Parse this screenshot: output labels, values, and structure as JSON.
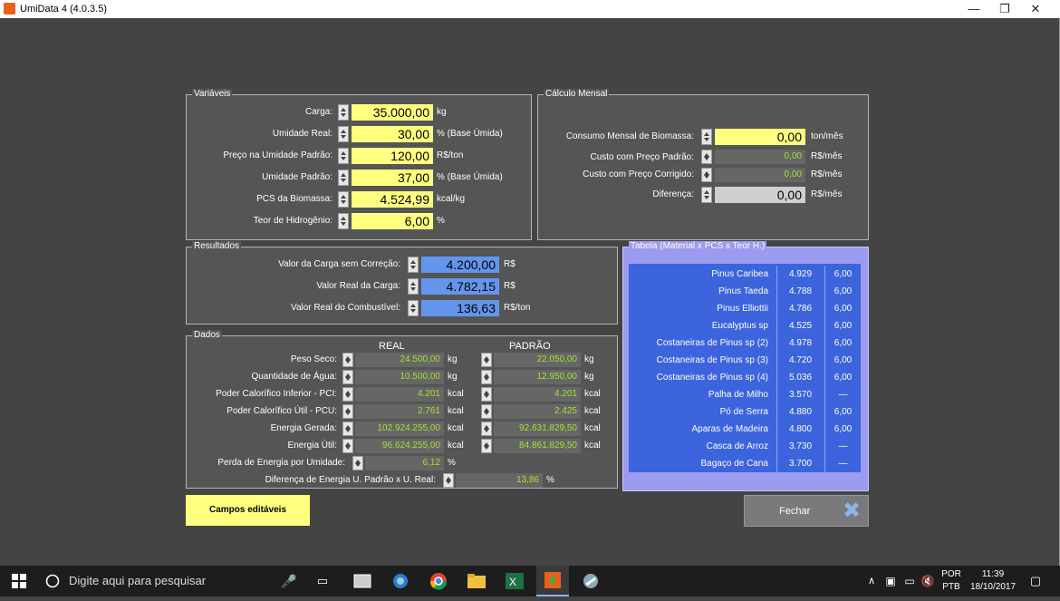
{
  "window": {
    "title": "UmiData 4 (4.0.3.5)",
    "minimize": "—",
    "maximize": "❐",
    "close": "✕"
  },
  "variaveis": {
    "title": "Variáveis",
    "rows": [
      {
        "label": "Carga:",
        "value": "35.000,00",
        "unit": "kg"
      },
      {
        "label": "Umidade Real:",
        "value": "30,00",
        "unit": "% (Base Úmida)"
      },
      {
        "label": "Preço na Umidade Padrão:",
        "value": "120,00",
        "unit": "R$/ton"
      },
      {
        "label": "Umidade Padrão:",
        "value": "37,00",
        "unit": "% (Base Úmida)"
      },
      {
        "label": "PCS da Biomassa:",
        "value": "4.524,99",
        "unit": "kcal/kg"
      },
      {
        "label": "Teor de Hidrogênio:",
        "value": "6,00",
        "unit": "%"
      }
    ]
  },
  "calculo": {
    "title": "Cálculo Mensal",
    "rows": [
      {
        "label": "Consumo Mensal de Biomassa:",
        "value": "0,00",
        "unit": "ton/mês"
      },
      {
        "label": "Custo com Preço Padrão:",
        "value": "0,00",
        "unit": "R$/mês"
      },
      {
        "label": "Custo com Preço Corrigido:",
        "value": "0,00",
        "unit": "R$/mês"
      },
      {
        "label": "Diferença:",
        "value": "0,00",
        "unit": "R$/mês"
      }
    ]
  },
  "resultados": {
    "title": "Resultados",
    "rows": [
      {
        "label": "Valor da Carga sem Correção:",
        "value": "4.200,00",
        "unit": "R$"
      },
      {
        "label": "Valor Real da Carga:",
        "value": "4.782,15",
        "unit": "R$"
      },
      {
        "label": "Valor Real do Combustível:",
        "value": "136,63",
        "unit": "R$/ton"
      }
    ]
  },
  "dados": {
    "title": "Dados",
    "col_real": "REAL",
    "col_padrao": "PADRÃO",
    "rows": [
      {
        "label": "Peso Seco:",
        "real": "24.500,00",
        "real_unit": "kg",
        "padrao": "22.050,00",
        "padrao_unit": "kg"
      },
      {
        "label": "Quantidade de Água:",
        "real": "10.500,00",
        "real_unit": "kg",
        "padrao": "12.950,00",
        "padrao_unit": "kg"
      },
      {
        "label": "Poder Calorífico Inferior - PCI:",
        "real": "4.201",
        "real_unit": "kcal",
        "padrao": "4.201",
        "padrao_unit": "kcal"
      },
      {
        "label": "Poder Calorífico Útil - PCU:",
        "real": "2.761",
        "real_unit": "kcal",
        "padrao": "2.425",
        "padrao_unit": "kcal"
      },
      {
        "label": "Energia Gerada:",
        "real": "102.924.255,00",
        "real_unit": "kcal",
        "padrao": "92.631.829,50",
        "padrao_unit": "kcal"
      },
      {
        "label": "Energia Útil:",
        "real": "96.624.255,00",
        "real_unit": "kcal",
        "padrao": "84.861.829,50",
        "padrao_unit": "kcal"
      }
    ],
    "perda": {
      "label": "Perda de Energia por Umidade:",
      "value": "6,12",
      "unit": "%"
    },
    "diferenca": {
      "label": "Diferença de Energia U. Padrão x U. Real:",
      "value": "13,86",
      "unit": "%"
    }
  },
  "tabela": {
    "title": "Tabela (Material x PCS x Teor H.)",
    "rows": [
      {
        "name": "Pinus Caribea",
        "pcs": "4.929",
        "teor": "6,00"
      },
      {
        "name": "Pinus Taeda",
        "pcs": "4.788",
        "teor": "6,00"
      },
      {
        "name": "Pinus Elliottii",
        "pcs": "4.786",
        "teor": "6,00"
      },
      {
        "name": "Eucalyptus sp",
        "pcs": "4.525",
        "teor": "6,00"
      },
      {
        "name": "Costaneiras de Pinus sp (2)",
        "pcs": "4.978",
        "teor": "6,00"
      },
      {
        "name": "Costaneiras de Pinus sp (3)",
        "pcs": "4.720",
        "teor": "6,00"
      },
      {
        "name": "Costaneiras de Pinus sp (4)",
        "pcs": "5.036",
        "teor": "6,00"
      },
      {
        "name": "Palha de Milho",
        "pcs": "3.570",
        "teor": "—"
      },
      {
        "name": "Pó de Serra",
        "pcs": "4.880",
        "teor": "6,00"
      },
      {
        "name": "Aparas de Madeira",
        "pcs": "4.800",
        "teor": "6,00"
      },
      {
        "name": "Casca de Arroz",
        "pcs": "3.730",
        "teor": "—"
      },
      {
        "name": "Bagaço de Cana",
        "pcs": "3.700",
        "teor": "—"
      }
    ]
  },
  "legend": "Campos editáveis",
  "fechar": "Fechar",
  "taskbar": {
    "search_placeholder": "Digite aqui para pesquisar",
    "lang1": "POR",
    "lang2": "PTB",
    "time": "11:39",
    "date": "18/10/2017"
  },
  "colors": {
    "editable": "#ffff80",
    "result": "#6495ed",
    "table": "#3c64dc"
  }
}
